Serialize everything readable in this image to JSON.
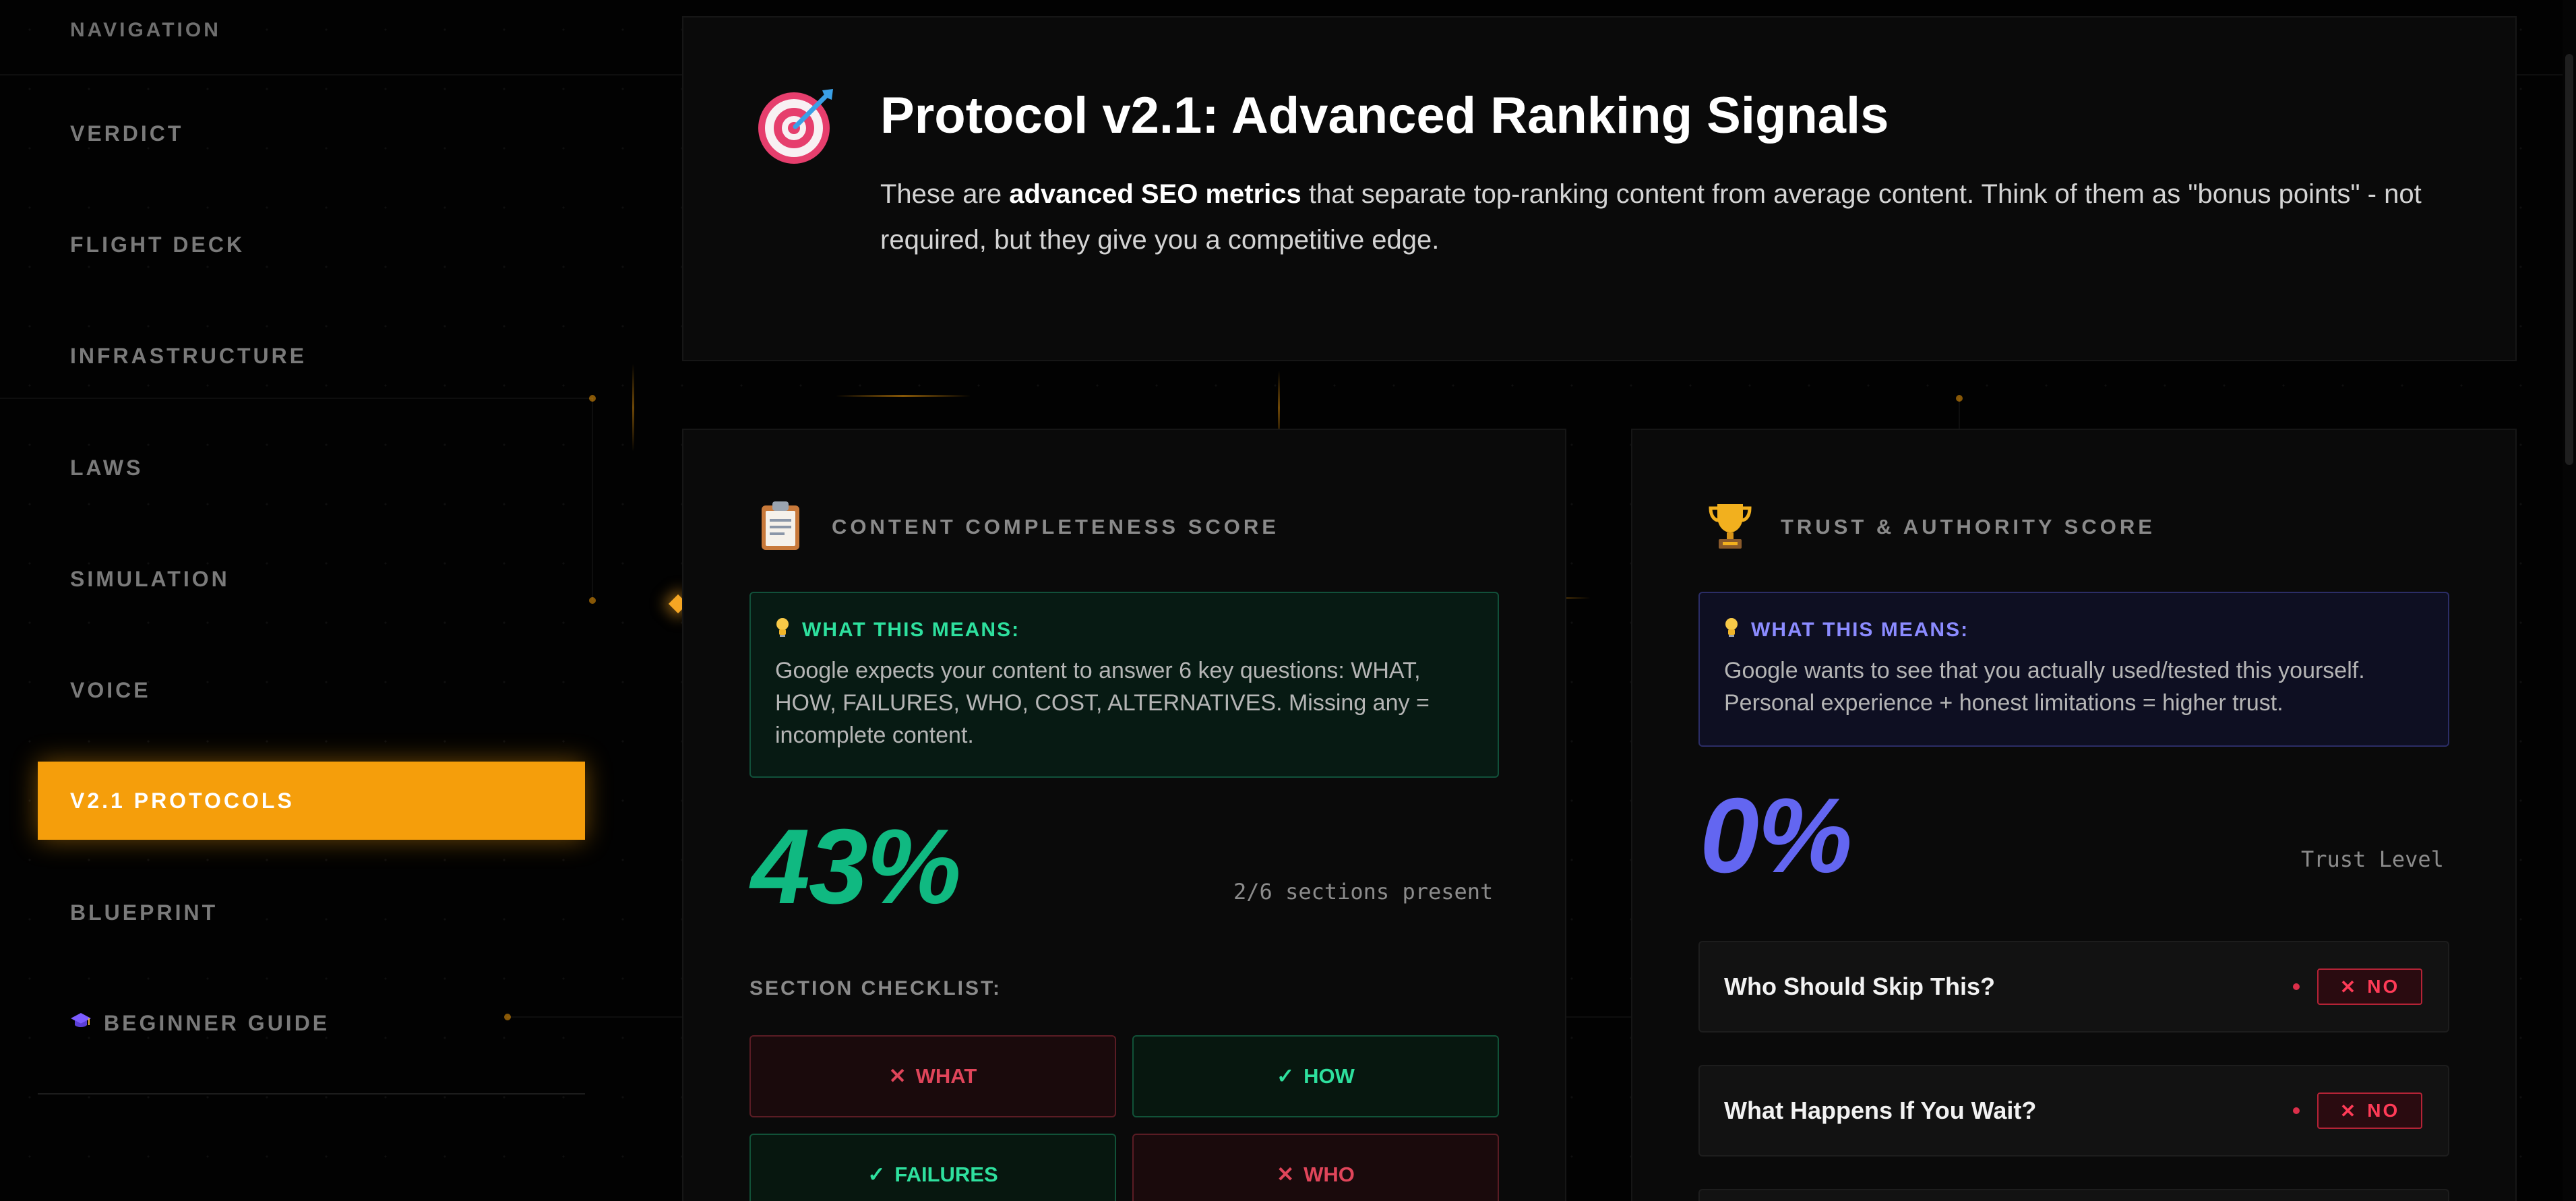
{
  "sidebar": {
    "heading": "NAVIGATION",
    "items": [
      {
        "label": "VERDICT"
      },
      {
        "label": "FLIGHT DECK"
      },
      {
        "label": "INFRASTRUCTURE"
      },
      {
        "label": "LAWS"
      },
      {
        "label": "SIMULATION"
      },
      {
        "label": "VOICE"
      },
      {
        "label": "V2.1 PROTOCOLS",
        "active": true
      },
      {
        "label": "BLUEPRINT"
      },
      {
        "label": "BEGINNER GUIDE",
        "icon": "graduation-cap-icon"
      }
    ]
  },
  "hero": {
    "icon": "target-icon",
    "title": "Protocol v2.1: Advanced Ranking Signals",
    "desc_pre": "These are ",
    "desc_bold": "advanced SEO metrics",
    "desc_post": " that separate top-ranking content from average content. Think of them as \"bonus points\" - not required, but they give you a competitive edge."
  },
  "completeness": {
    "icon": "clipboard-icon",
    "title": "CONTENT COMPLETENESS SCORE",
    "info_heading": "WHAT THIS MEANS:",
    "info_body": "Google expects your content to answer 6 key questions: WHAT, HOW, FAILURES, WHO, COST, ALTERNATIVES. Missing any = incomplete content.",
    "score": "43%",
    "score_note": "2/6 sections present",
    "checklist_label": "SECTION CHECKLIST:",
    "checklist": [
      {
        "label": "WHAT",
        "present": false,
        "mark": "✕"
      },
      {
        "label": "HOW",
        "present": true,
        "mark": "✓"
      },
      {
        "label": "FAILURES",
        "present": true,
        "mark": "✓"
      },
      {
        "label": "WHO",
        "present": false,
        "mark": "✕"
      }
    ]
  },
  "trust": {
    "icon": "trophy-icon",
    "title": "TRUST & AUTHORITY SCORE",
    "info_heading": "WHAT THIS MEANS:",
    "info_body": "Google wants to see that you actually used/tested this yourself. Personal experience + honest limitations = higher trust.",
    "score": "0%",
    "score_note": "Trust Level",
    "questions": [
      {
        "label": "Who Should Skip This?",
        "status": "NO",
        "mark": "✕"
      },
      {
        "label": "What Happens If You Wait?",
        "status": "NO",
        "mark": "✕"
      }
    ]
  },
  "colors": {
    "accent": "#f59e0b",
    "success": "#10b981",
    "danger": "#e0455a",
    "indigo": "#6366f1"
  }
}
